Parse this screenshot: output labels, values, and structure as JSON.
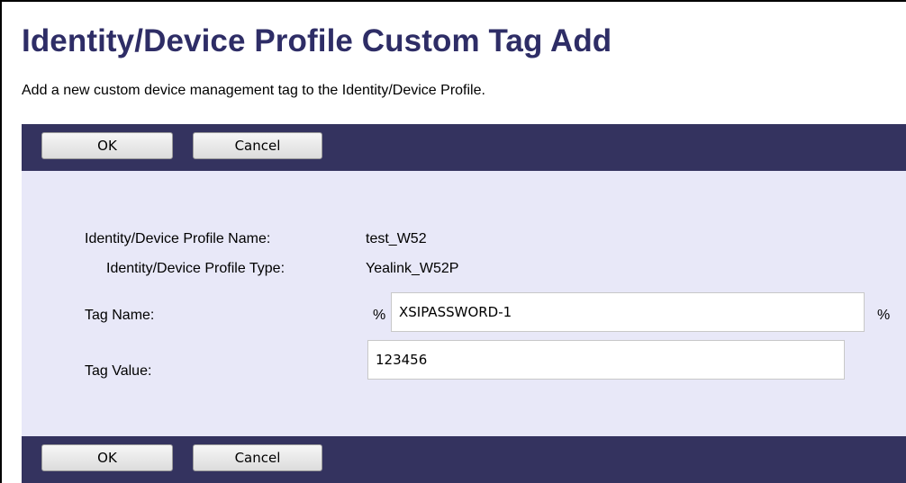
{
  "header": {
    "title": "Identity/Device Profile Custom Tag Add",
    "description": "Add a new custom device management tag to the Identity/Device Profile."
  },
  "toolbar": {
    "ok_label": "OK",
    "cancel_label": "Cancel"
  },
  "form": {
    "profile_name_label": "Identity/Device Profile Name:",
    "profile_name_value": "test_W52",
    "profile_type_label": "Identity/Device Profile Type:",
    "profile_type_value": "Yealink_W52P",
    "tag_name_label": "Tag Name:",
    "tag_name_prefix": "%",
    "tag_name_value": "XSIPASSWORD-1",
    "tag_name_suffix": "%",
    "tag_value_label": "Tag Value:",
    "tag_value_value": "123456"
  },
  "colors": {
    "title": "#2e2d66",
    "bar": "#34335f",
    "panel": "#e8e8f8"
  }
}
